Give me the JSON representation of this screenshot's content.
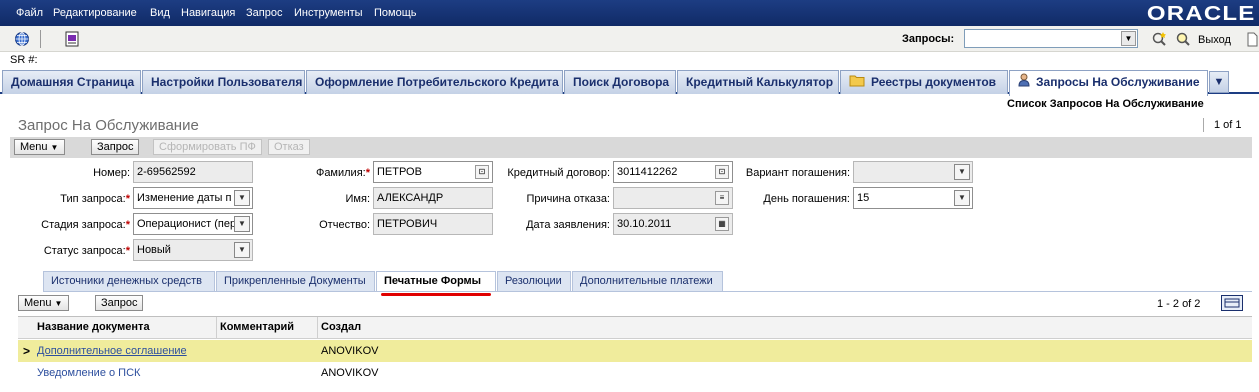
{
  "menu": {
    "items": [
      "Файл",
      "Редактирование",
      "Вид",
      "Навигация",
      "Запрос",
      "Инструменты",
      "Помощь"
    ],
    "logo": "ORACLE"
  },
  "toolbar": {
    "queries_label": "Запросы:",
    "queries_value": "",
    "exit_label": "Выход"
  },
  "sr": {
    "label": "SR #:"
  },
  "tabs": [
    {
      "label": "Домашняя Страница"
    },
    {
      "label": "Настройки Пользователя"
    },
    {
      "label": "Оформление Потребительского Кредита"
    },
    {
      "label": "Поиск Договора"
    },
    {
      "label": "Кредитный Калькулятор"
    },
    {
      "label": "Реестры документов"
    },
    {
      "label": "Запросы На Обслуживание"
    }
  ],
  "sublink": "Список Запросов На Обслуживание",
  "applet": {
    "title": "Запрос На Обслуживание",
    "pager": "1 of 1",
    "buttons": {
      "menu": "Menu",
      "query": "Запрос",
      "print": "Сформировать ПФ",
      "refuse": "Отказ"
    }
  },
  "form": {
    "number": {
      "label": "Номер:",
      "value": "2-69562592"
    },
    "type": {
      "label": "Тип запроса:",
      "value": "Изменение даты п"
    },
    "stage": {
      "label": "Стадия запроса:",
      "value": "Операционист (пер"
    },
    "status": {
      "label": "Статус запроса:",
      "value": "Новый"
    },
    "lastname": {
      "label": "Фамилия:",
      "value": "ПЕТРОВ"
    },
    "firstname": {
      "label": "Имя:",
      "value": "АЛЕКСАНДР"
    },
    "middlename": {
      "label": "Отчество:",
      "value": "ПЕТРОВИЧ"
    },
    "contract": {
      "label": "Кредитный договор:",
      "value": "3011412262"
    },
    "refusal": {
      "label": "Причина отказа:",
      "value": ""
    },
    "app_date": {
      "label": "Дата заявления:",
      "value": "30.10.2011"
    },
    "repay_variant": {
      "label": "Вариант погашения:",
      "value": ""
    },
    "repay_day": {
      "label": "День погашения:",
      "value": "15"
    }
  },
  "subtabs": [
    {
      "label": "Источники денежных средств"
    },
    {
      "label": "Прикрепленные Документы"
    },
    {
      "label": "Печатные Формы"
    },
    {
      "label": "Резолюции"
    },
    {
      "label": "Дополнительные платежи"
    }
  ],
  "list": {
    "menu": "Menu",
    "query": "Запрос",
    "count": "1 - 2 of 2",
    "columns": [
      "Название документа",
      "Комментарий",
      "Создал"
    ],
    "rows": [
      {
        "name": "Дополнительное соглашение",
        "comment": "",
        "created_by": "ANOVIKOV"
      },
      {
        "name": "Уведомление о ПСК",
        "comment": "",
        "created_by": "ANOVIKOV"
      }
    ]
  }
}
